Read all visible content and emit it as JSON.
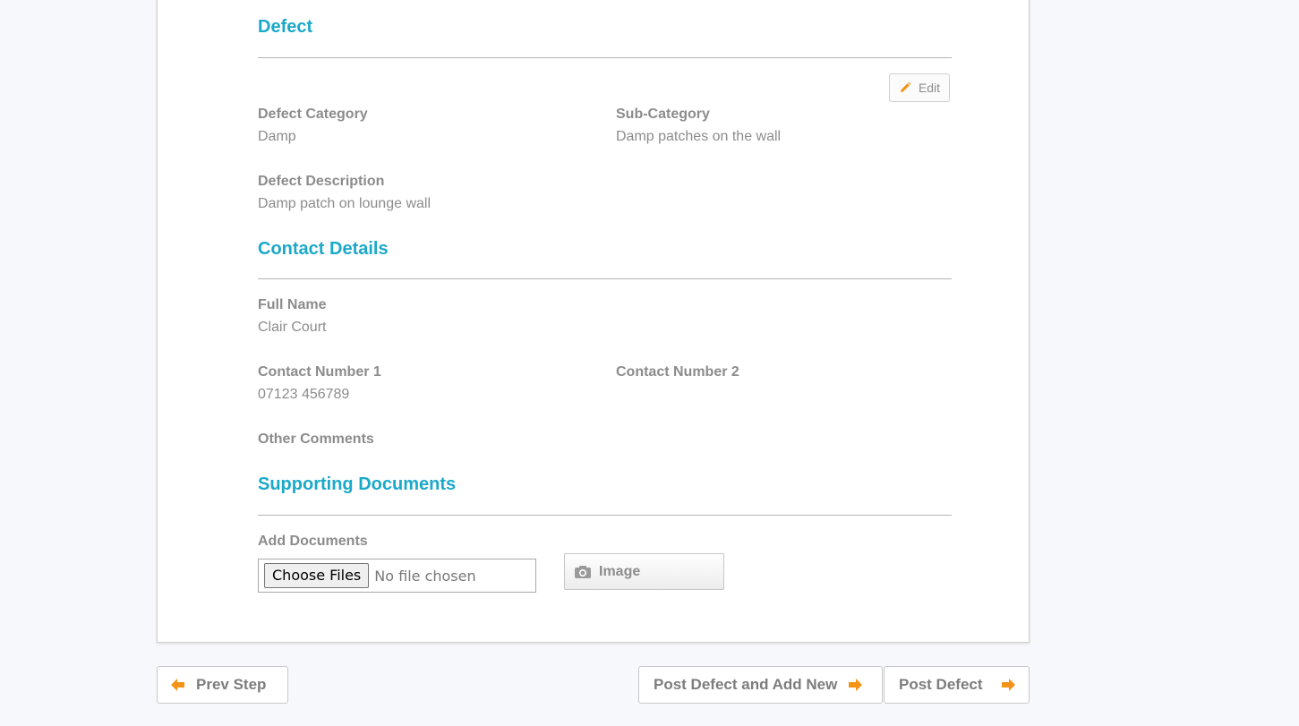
{
  "defect": {
    "title": "Defect",
    "edit_label": "Edit",
    "category_label": "Defect Category",
    "category_value": "Damp",
    "subcategory_label": "Sub-Category",
    "subcategory_value": "Damp patches on the wall",
    "description_label": "Defect Description",
    "description_value": "Damp patch on lounge wall"
  },
  "contact": {
    "title": "Contact Details",
    "full_name_label": "Full Name",
    "full_name_value": "Clair Court",
    "contact1_label": "Contact Number 1",
    "contact1_value": "07123 456789",
    "contact2_label": "Contact Number 2",
    "comments_label": "Other Comments"
  },
  "documents": {
    "title": "Supporting Documents",
    "add_label": "Add Documents",
    "choose_files_label": "Choose Files",
    "no_file_text": "No file chosen",
    "image_button_label": "Image"
  },
  "footer": {
    "prev_label": "Prev Step",
    "post_add_new_label": "Post Defect and Add New",
    "post_label": "Post Defect"
  },
  "colors": {
    "accent_heading": "#1ba9c9",
    "arrow_orange": "#f39419",
    "text_grey": "#8c8c8c"
  },
  "icons": {
    "edit": "pencil-icon",
    "image": "camera-icon",
    "prev": "arrow-left-icon",
    "next": "arrow-right-icon"
  }
}
